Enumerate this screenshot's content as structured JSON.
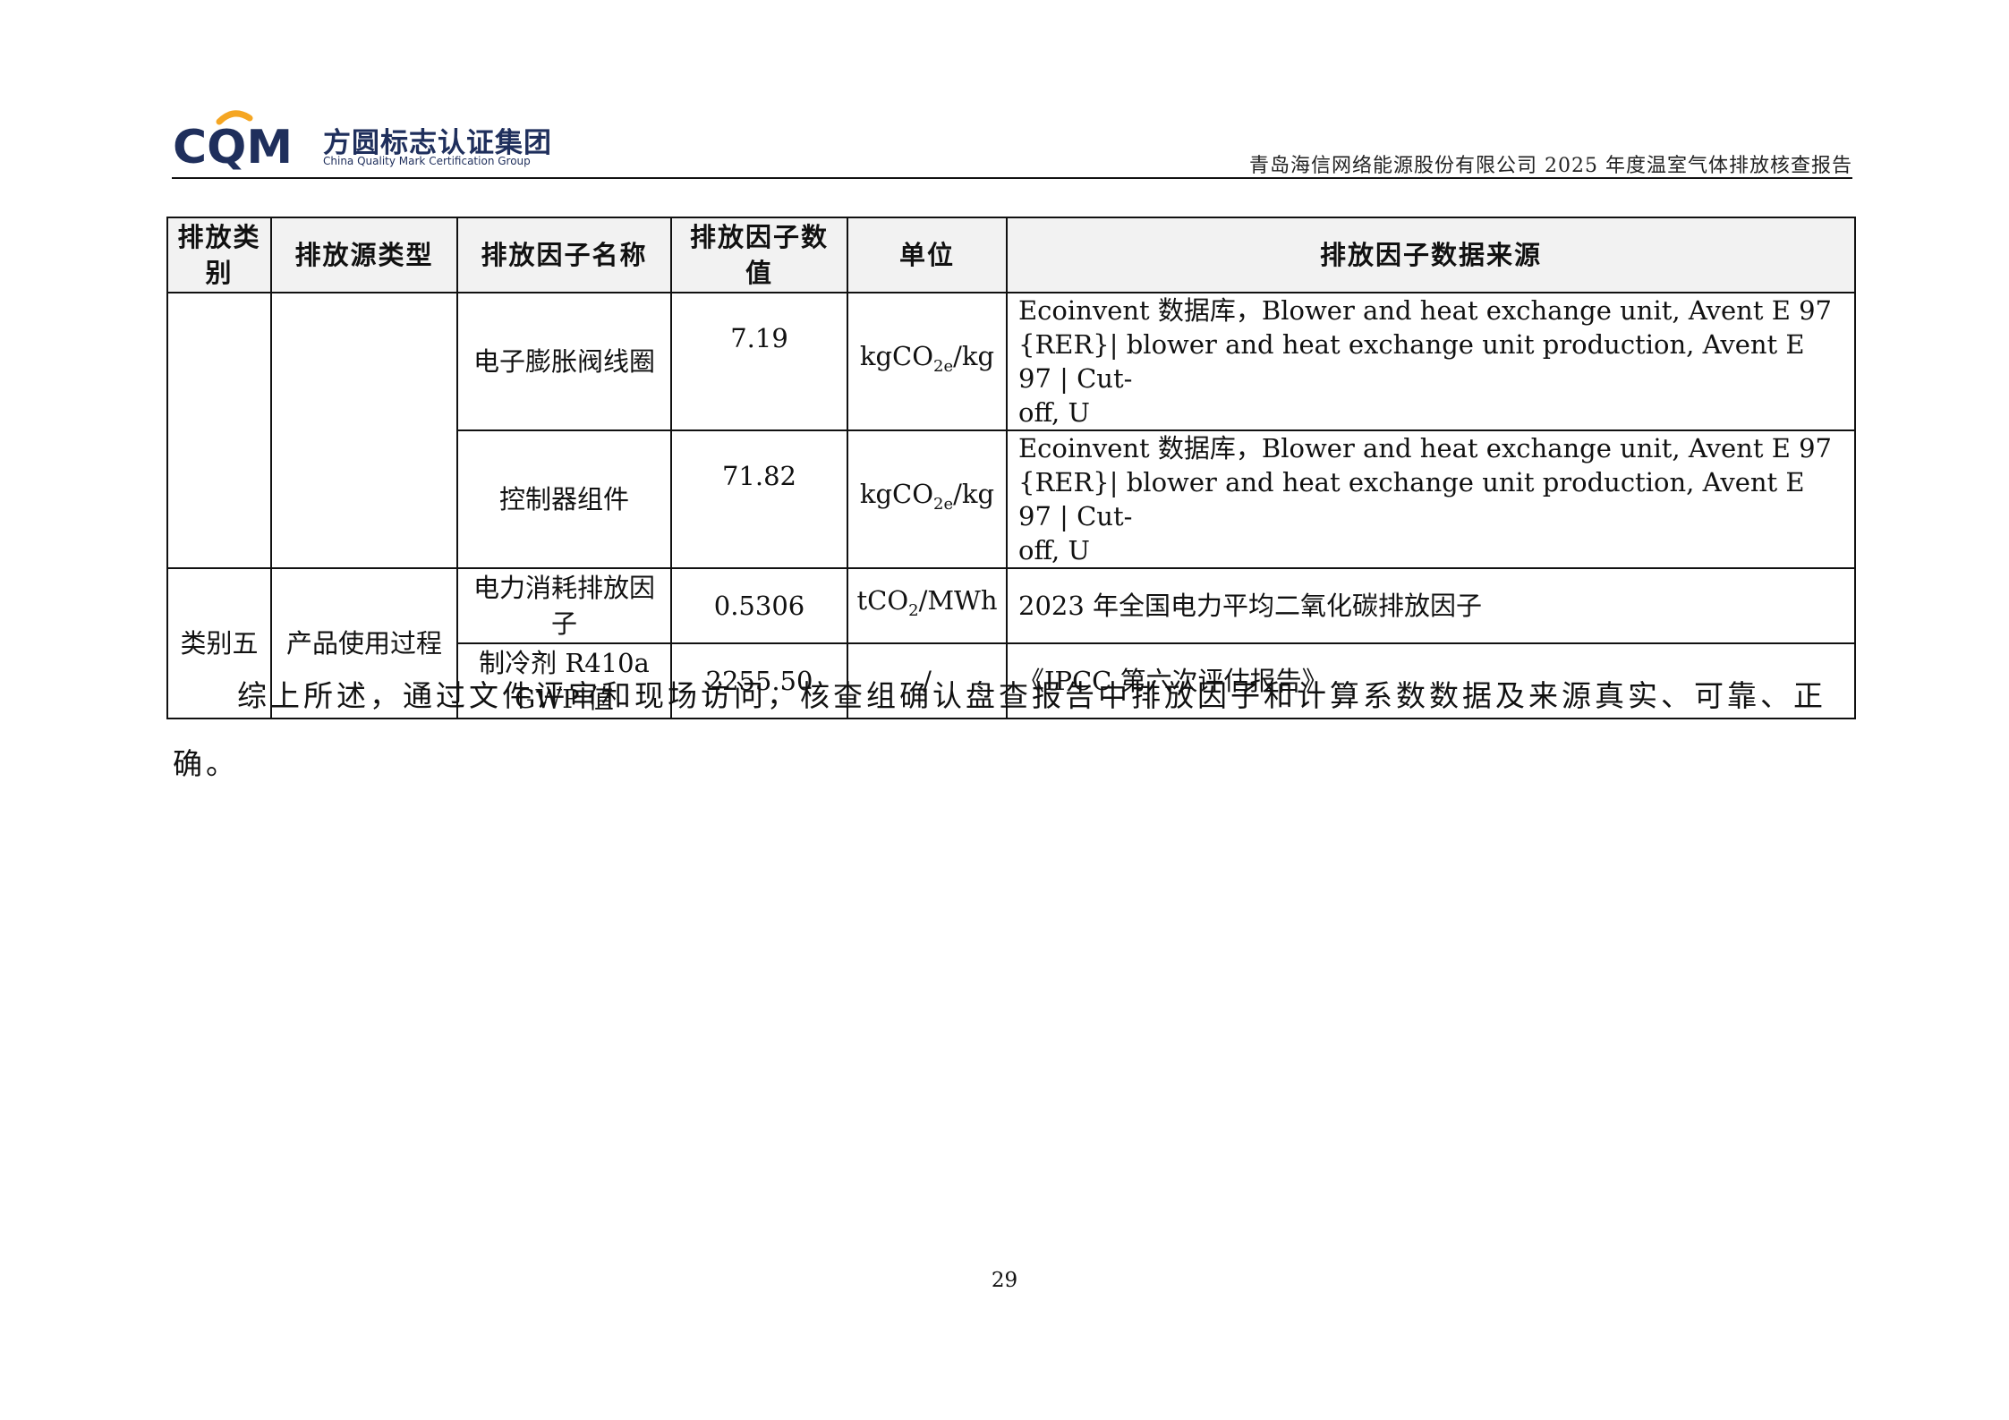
{
  "header": {
    "logo_mark": "CQM",
    "logo_cn": "方圆标志认证集团",
    "logo_en": "China Quality Mark Certification Group",
    "report_title": "青岛海信网络能源股份有限公司 2025 年度温室气体排放核查报告",
    "brand_colors": {
      "navy": "#1f2f5c",
      "orange": "#f5a623"
    }
  },
  "table": {
    "headers": [
      "排放类别",
      "排放源类型",
      "排放因子名称",
      "排放因子数值",
      "单位",
      "排放因子数据来源"
    ],
    "rows": [
      {
        "category": "",
        "source_type": "",
        "factor_name": "电子膨胀阀线圈",
        "value": "7.19",
        "unit_prefix": "kgCO",
        "unit_sub": "2e",
        "unit_suffix": "/kg",
        "source_lines": [
          "Ecoinvent 数据库，Blower and heat exchange unit, Avent E 97",
          "{RER}| blower and heat exchange unit production, Avent E 97 | Cut-",
          "off, U"
        ]
      },
      {
        "factor_name": "控制器组件",
        "value": "71.82",
        "unit_prefix": "kgCO",
        "unit_sub": "2e",
        "unit_suffix": "/kg",
        "source_lines": [
          "Ecoinvent 数据库，Blower and heat exchange unit, Avent E 97",
          "{RER}| blower and heat exchange unit production, Avent E 97 | Cut-",
          "off, U"
        ]
      },
      {
        "category": "类别五",
        "source_type": "产品使用过程",
        "factor_name": "电力消耗排放因子",
        "value": "0.5306",
        "unit_prefix": "tCO",
        "unit_sub": "2",
        "unit_suffix": "/MWh",
        "source": "2023 年全国电力平均二氧化碳排放因子"
      },
      {
        "factor_name": "制冷剂 R410a GWP 值",
        "value": "2255.50",
        "unit": "/",
        "source": "《IPCC 第六次评估报告》"
      }
    ]
  },
  "paragraph": "综上所述，通过文件评审和现场访问，核查组确认盘查报告中排放因子和计算系数数据及来源真实、可靠、正确。",
  "page_number": "29"
}
